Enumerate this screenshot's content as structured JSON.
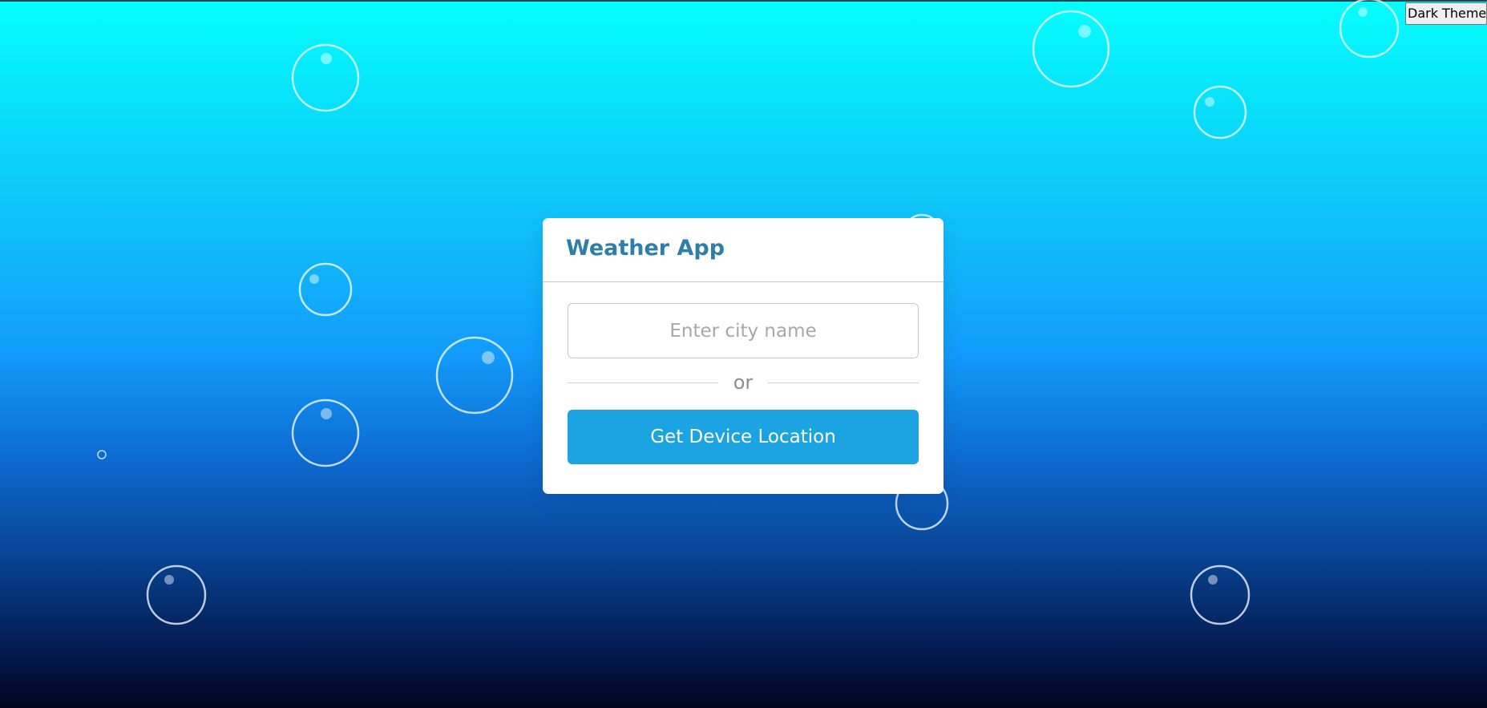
{
  "theme_toggle": {
    "label": "Dark Theme"
  },
  "card": {
    "title": "Weather App",
    "city_input": {
      "placeholder": "Enter city name",
      "value": ""
    },
    "divider_text": "or",
    "location_button": "Get Device Location"
  },
  "colors": {
    "title": "#2b7fa8",
    "button": "#1ca3e1",
    "gradient_top": "#04ffff",
    "gradient_mid": "#129bfb",
    "gradient_bottom": "#01051f"
  }
}
